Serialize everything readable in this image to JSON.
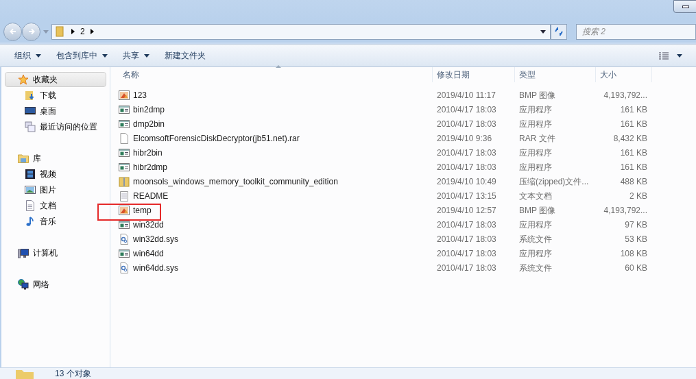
{
  "address_bar": {
    "path": [
      {
        "label": "2"
      }
    ],
    "search": {
      "placeholder": "搜索 2"
    }
  },
  "toolbar": {
    "items": [
      {
        "label": "组织",
        "dropdown": true
      },
      {
        "label": "包含到库中",
        "dropdown": true
      },
      {
        "label": "共享",
        "dropdown": true
      },
      {
        "label": "新建文件夹",
        "dropdown": false
      }
    ]
  },
  "sidebar": {
    "groups": [
      {
        "label": "收藏夹",
        "kind": "star",
        "selected": true,
        "children": [
          {
            "label": "下载",
            "kind": "download",
            "selected": false
          },
          {
            "label": "桌面",
            "kind": "desktop",
            "selected": false
          },
          {
            "label": "最近访问的位置",
            "kind": "recent",
            "selected": false
          }
        ]
      },
      {
        "label": "库",
        "kind": "library",
        "selected": false,
        "children": [
          {
            "label": "视频",
            "kind": "video",
            "selected": false
          },
          {
            "label": "图片",
            "kind": "picture",
            "selected": false
          },
          {
            "label": "文档",
            "kind": "document",
            "selected": false
          },
          {
            "label": "音乐",
            "kind": "music",
            "selected": false
          }
        ]
      },
      {
        "label": "计算机",
        "kind": "computer",
        "selected": false
      },
      {
        "label": "网络",
        "kind": "network",
        "selected": false
      }
    ]
  },
  "table": {
    "columns": [
      "名称",
      "修改日期",
      "类型",
      "大小"
    ],
    "rows": [
      {
        "kind": "bmp",
        "name": "123",
        "date": "2019/4/10 11:17",
        "type": "BMP 图像",
        "size": "4,193,792..."
      },
      {
        "kind": "exe",
        "name": "bin2dmp",
        "date": "2010/4/17 18:03",
        "type": "应用程序",
        "size": "161 KB"
      },
      {
        "kind": "exe",
        "name": "dmp2bin",
        "date": "2010/4/17 18:03",
        "type": "应用程序",
        "size": "161 KB"
      },
      {
        "kind": "rar",
        "name": "ElcomsoftForensicDiskDecryptor(jb51.net).rar",
        "date": "2019/4/10 9:36",
        "type": "RAR 文件",
        "size": "8,432 KB"
      },
      {
        "kind": "exe",
        "name": "hibr2bin",
        "date": "2010/4/17 18:03",
        "type": "应用程序",
        "size": "161 KB"
      },
      {
        "kind": "exe",
        "name": "hibr2dmp",
        "date": "2010/4/17 18:03",
        "type": "应用程序",
        "size": "161 KB"
      },
      {
        "kind": "zip",
        "name": "moonsols_windows_memory_toolkit_community_edition",
        "date": "2019/4/10 10:49",
        "type": "压缩(zipped)文件...",
        "size": "488 KB"
      },
      {
        "kind": "txt",
        "name": "README",
        "date": "2010/4/17 13:15",
        "type": "文本文档",
        "size": "2 KB"
      },
      {
        "kind": "bmp",
        "name": "temp",
        "date": "2019/4/10 12:57",
        "type": "BMP 图像",
        "size": "4,193,792..."
      },
      {
        "kind": "exe",
        "name": "win32dd",
        "date": "2010/4/17 18:03",
        "type": "应用程序",
        "size": "97 KB"
      },
      {
        "kind": "sys",
        "name": "win32dd.sys",
        "date": "2010/4/17 18:03",
        "type": "系统文件",
        "size": "53 KB"
      },
      {
        "kind": "exe",
        "name": "win64dd",
        "date": "2010/4/17 18:03",
        "type": "应用程序",
        "size": "108 KB"
      },
      {
        "kind": "sys",
        "name": "win64dd.sys",
        "date": "2010/4/17 18:03",
        "type": "系统文件",
        "size": "60 KB"
      }
    ]
  },
  "status_bar": {
    "text": "13 个对象"
  }
}
